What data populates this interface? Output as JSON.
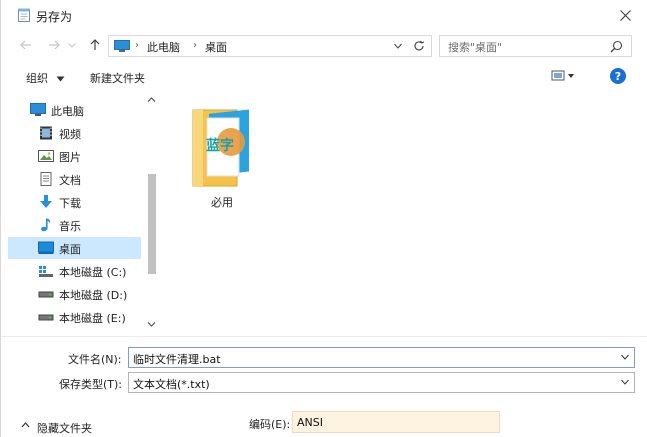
{
  "window": {
    "title": "另存为"
  },
  "address": {
    "crumbs": [
      "此电脑",
      "桌面"
    ]
  },
  "search": {
    "placeholder": "搜索\"桌面\""
  },
  "toolbar": {
    "organize_label": "组织",
    "new_folder_label": "新建文件夹",
    "help_label": "?"
  },
  "sidebar": {
    "items": [
      {
        "label": "此电脑",
        "icon": "computer-icon"
      },
      {
        "label": "视频",
        "icon": "video-icon"
      },
      {
        "label": "图片",
        "icon": "picture-icon"
      },
      {
        "label": "文档",
        "icon": "document-icon"
      },
      {
        "label": "下载",
        "icon": "download-icon"
      },
      {
        "label": "音乐",
        "icon": "music-icon"
      },
      {
        "label": "桌面",
        "icon": "desktop-icon",
        "selected": true
      },
      {
        "label": "本地磁盘 (C:)",
        "icon": "drive-c-icon"
      },
      {
        "label": "本地磁盘 (D:)",
        "icon": "drive-icon"
      },
      {
        "label": "本地磁盘 (E:)",
        "icon": "drive-icon"
      }
    ]
  },
  "files": [
    {
      "name": "必用",
      "type": "folder",
      "overlay_text": "蓝字"
    }
  ],
  "form": {
    "filename_label": "文件名(N):",
    "filename_value": "临时文件清理.bat",
    "filetype_label": "保存类型(T):",
    "filetype_value": "文本文档(*.txt)",
    "encoding_label": "编码(E):",
    "encoding_value": "ANSI",
    "hide_folders_label": "隐藏文件夹"
  },
  "colors": {
    "selection": "#cce8ff",
    "accent": "#1a6fd2",
    "folder": "#f5c24a"
  }
}
